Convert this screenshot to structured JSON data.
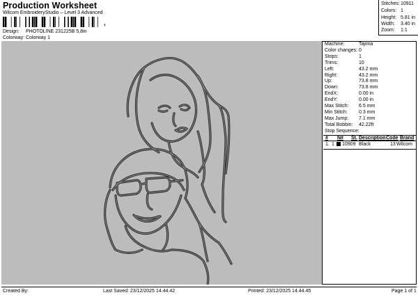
{
  "header": {
    "title": "Production Worksheet",
    "subtitle": "Wilcom EmbroideryStudio – Level 3 Advanced",
    "barcode_suffix": ",",
    "design_label": "Design:",
    "design_value": "PHOTOLINE 231225B 5,8in",
    "colorway_label": "Colorway:",
    "colorway_value": "Colorway 1"
  },
  "summary": {
    "stitches_label": "Stitches:",
    "stitches_value": "10911",
    "colors_label": "Colors:",
    "colors_value": "1",
    "height_label": "Height:",
    "height_value": "5.81 in",
    "width_label": "Width:",
    "width_value": "3.40 in",
    "zoom_label": "Zoom:",
    "zoom_value": "1:1"
  },
  "machine_info": [
    {
      "label": "Machine:",
      "value": "Tajima"
    },
    {
      "label": "Color changes:",
      "value": "0"
    },
    {
      "label": "Stops:",
      "value": "1"
    },
    {
      "label": "Trims:",
      "value": "10"
    },
    {
      "label": "Left:",
      "value": "43.2 mm"
    },
    {
      "label": "Right:",
      "value": "43.2 mm"
    },
    {
      "label": "Up:",
      "value": "73.8 mm"
    },
    {
      "label": "Down:",
      "value": "73.8 mm"
    },
    {
      "label": "EndX:",
      "value": "0.00 in"
    },
    {
      "label": "EndY:",
      "value": "0.00 in"
    },
    {
      "label": "Max Stitch:",
      "value": "6.5 mm"
    },
    {
      "label": "Min Stitch:",
      "value": "0.3 mm"
    },
    {
      "label": "Max Jump:",
      "value": "7.1 mm"
    },
    {
      "label": "Total Bobbin:",
      "value": "42.22ft"
    }
  ],
  "stop_sequence": {
    "title": "Stop Sequence:",
    "columns": [
      "#",
      "N#",
      "St.",
      "Description",
      "Code",
      "Brand"
    ],
    "rows": [
      {
        "index": "1.",
        "needle": "1",
        "swatch_color": "#000000",
        "stitches": "10909",
        "description": "Black",
        "code": "13",
        "brand": "Wilcom"
      }
    ]
  },
  "footer": {
    "created_by": "Created By:",
    "last_saved": "Last Saved: 23/12/2025 14.44.42",
    "printed": "Printed: 23/12/2025 14.44.45",
    "page": "Page 1 of 1"
  },
  "colors": {
    "canvas_background": "#bcbcbc",
    "thread_outline": "#2a2a2a",
    "thread_fill": "#8c8c8c"
  }
}
